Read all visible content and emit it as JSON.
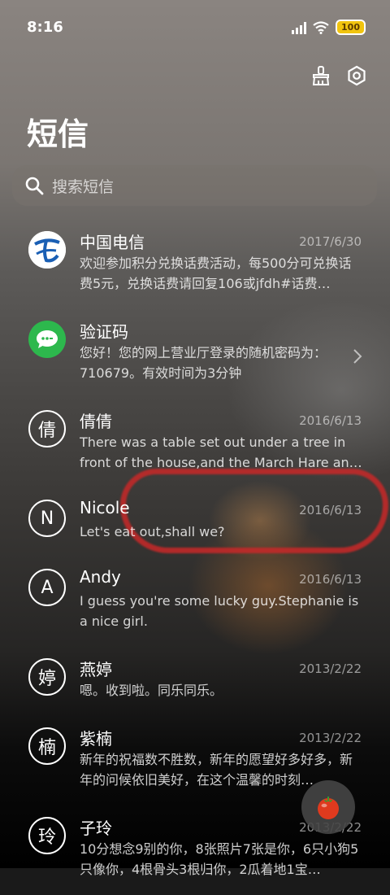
{
  "status_bar": {
    "time": "8:16",
    "battery": "100"
  },
  "header": {
    "title": "短信"
  },
  "search": {
    "placeholder": "搜索短信"
  },
  "colors": {
    "accent_green": "#2db84d",
    "battery_yellow": "#f1c40f",
    "telecom_blue": "#1a5fb4"
  },
  "messages": [
    {
      "name": "中国电信",
      "date": "2017/6/30",
      "preview": "欢迎参加积分兑换话费活动，每500分可兑换话费5元，兑换话费请回复106或jfdh#话费…",
      "avatar": "telecom-logo"
    },
    {
      "name": "验证码",
      "date": "",
      "preview": "您好！您的网上营业厅登录的随机密码为：710679。有效时间为3分钟",
      "avatar": "message-icon"
    },
    {
      "name": "倩倩",
      "date": "2016/6/13",
      "preview": "There was a table set out under a tree in front of the house,and the March Hare an…",
      "avatar": "倩"
    },
    {
      "name": "Nicole",
      "date": "2016/6/13",
      "preview": "Let's eat out,shall we?",
      "avatar": "N"
    },
    {
      "name": "Andy",
      "date": "2016/6/13",
      "preview": "I guess you're some lucky guy.Stephanie is a nice girl.",
      "avatar": "A"
    },
    {
      "name": "燕婷",
      "date": "2013/2/22",
      "preview": "嗯。收到啦。同乐同乐。",
      "avatar": "婷"
    },
    {
      "name": "紫楠",
      "date": "2013/2/22",
      "preview": "新年的祝福数不胜数，新年的愿望好多好多，新年的问候依旧美好，在这个温馨的时刻…",
      "avatar": "楠"
    },
    {
      "name": "子玲",
      "date": "2013/2/22",
      "preview": "10分想念9别的你，8张照片7张是你，6只小狗5只像你，4根骨头3根归你，2瓜着地1宝…",
      "avatar": "玲"
    }
  ]
}
